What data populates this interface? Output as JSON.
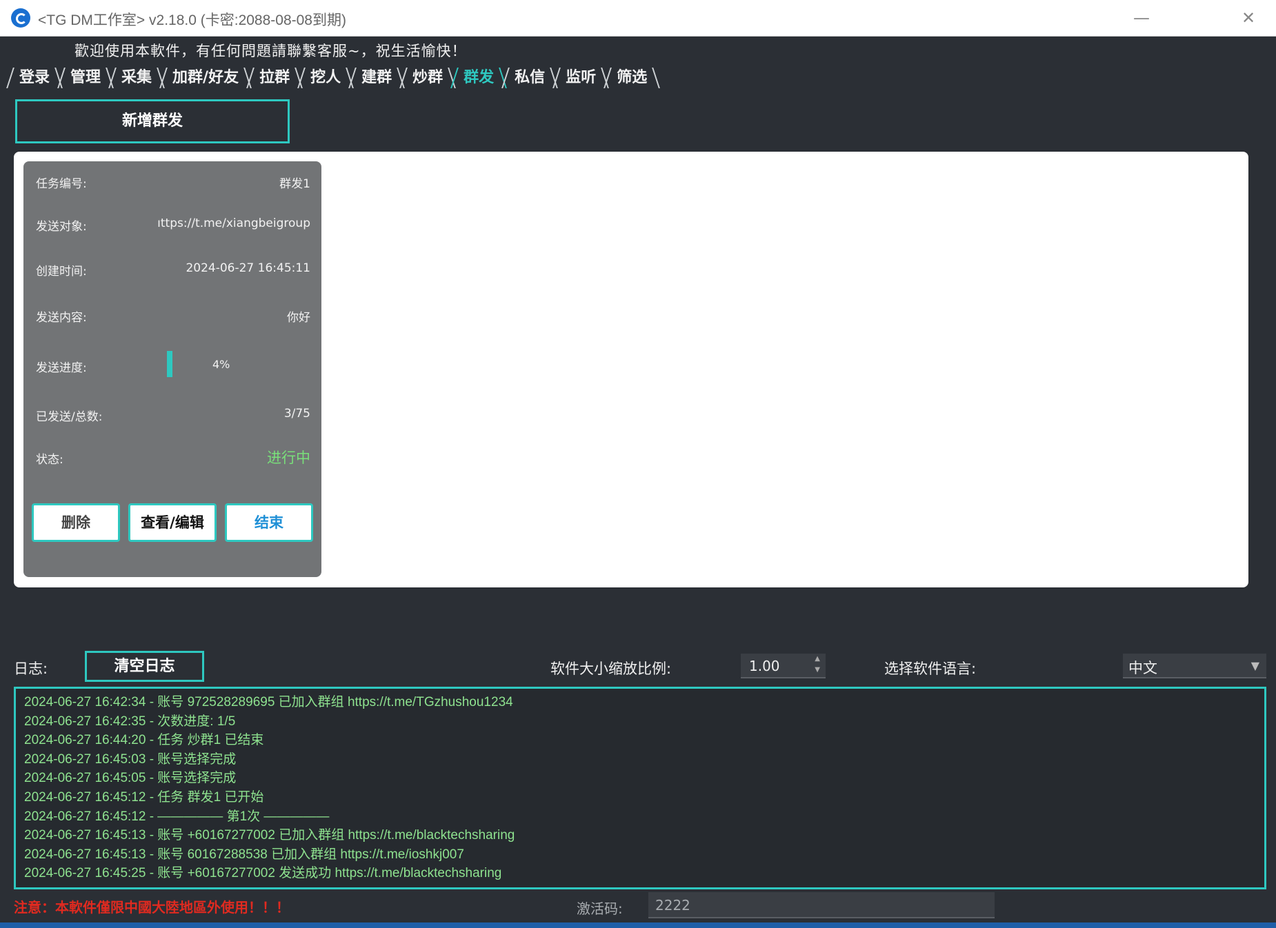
{
  "window": {
    "title": "<TG DM工作室> v2.18.0 (卡密:2088-08-08到期)",
    "minimize_glyph": "—",
    "close_glyph": "✕"
  },
  "welcome_text": "歡迎使用本軟件，有任何問題請聯繫客服~，祝生活愉快！",
  "tabs": [
    {
      "label": "登录"
    },
    {
      "label": "管理"
    },
    {
      "label": "采集"
    },
    {
      "label": "加群/好友"
    },
    {
      "label": "拉群"
    },
    {
      "label": "挖人"
    },
    {
      "label": "建群"
    },
    {
      "label": "炒群"
    },
    {
      "label": "群发",
      "active": true
    },
    {
      "label": "私信"
    },
    {
      "label": "监听"
    },
    {
      "label": "筛选"
    }
  ],
  "new_button_label": "新增群发",
  "task_card": {
    "task_id_label": "任务编号:",
    "task_id": "群发1",
    "target_label": "发送对象:",
    "target": "ıttps://t.me/xiangbeigroup",
    "created_label": "创建时间:",
    "created": "2024-06-27 16:45:11",
    "content_label": "发送内容:",
    "content": "你好",
    "progress_label": "发送进度:",
    "progress_percent": 4,
    "progress_text": "4%",
    "sent_total_label": "已发送/总数:",
    "sent_total": "3/75",
    "status_label": "状态:",
    "status": "进行中",
    "delete_label": "删除",
    "view_edit_label": "查看/编辑",
    "end_label": "结束"
  },
  "log": {
    "label": "日志:",
    "clear_label": "清空日志",
    "scale_label": "软件大小缩放比例:",
    "scale_value": "1.00",
    "language_label": "选择软件语言:",
    "language_value": "中文",
    "lines": [
      "2024-06-27 16:42:34 - 账号 972528289695 已加入群组 https://t.me/TGzhushou1234",
      "2024-06-27 16:42:35 - 次数进度: 1/5",
      "2024-06-27 16:44:20 - 任务 炒群1 已结束",
      "2024-06-27 16:45:03 - 账号选择完成",
      "2024-06-27 16:45:05 - 账号选择完成",
      "2024-06-27 16:45:12 - 任务 群发1 已开始",
      "2024-06-27 16:45:12 - ————— 第1次 —————",
      "2024-06-27 16:45:13 - 账号 +60167277002 已加入群组 https://t.me/blacktechsharing",
      "2024-06-27 16:45:13 - 账号 60167288538 已加入群组 https://t.me/ioshkj007",
      "2024-06-27 16:45:25 - 账号 +60167277002 发送成功 https://t.me/blacktechsharing"
    ]
  },
  "footer": {
    "warning": "注意：本軟件僅限中國大陸地區外使用！！！",
    "activation_label": "激活码:",
    "activation_value": "2222"
  },
  "colors": {
    "accent": "#2ec8c0",
    "log_text": "#8ee28f",
    "warning": "#e02a20",
    "background": "#2b2f35"
  }
}
